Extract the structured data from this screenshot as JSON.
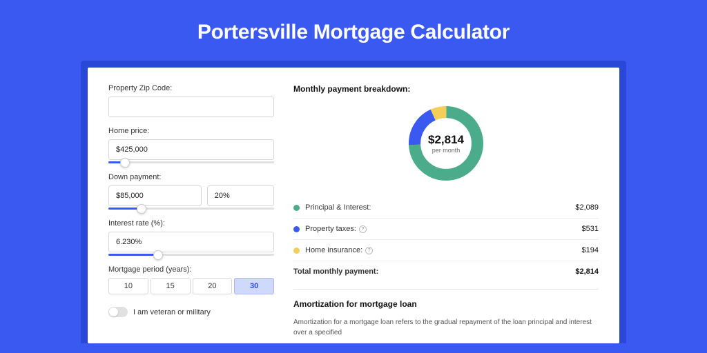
{
  "title": "Portersville Mortgage Calculator",
  "form": {
    "zip_label": "Property Zip Code:",
    "zip_value": "",
    "home_price_label": "Home price:",
    "home_price_value": "$425,000",
    "down_payment_label": "Down payment:",
    "down_payment_amount": "$85,000",
    "down_payment_percent": "20%",
    "interest_label": "Interest rate (%):",
    "interest_value": "6.230%",
    "period_label": "Mortgage period (years):",
    "periods": [
      "10",
      "15",
      "20",
      "30"
    ],
    "period_active": "30",
    "veteran_label": "I am veteran or military"
  },
  "breakdown": {
    "title": "Monthly payment breakdown:",
    "center_amount": "$2,814",
    "center_sub": "per month",
    "lines": [
      {
        "label": "Principal & Interest:",
        "value": "$2,089",
        "color": "#4bac8b",
        "info": false
      },
      {
        "label": "Property taxes:",
        "value": "$531",
        "color": "#3a59f0",
        "info": true
      },
      {
        "label": "Home insurance:",
        "value": "$194",
        "color": "#f3cf5a",
        "info": true
      }
    ],
    "total_label": "Total monthly payment:",
    "total_value": "$2,814"
  },
  "amort": {
    "title": "Amortization for mortgage loan",
    "text": "Amortization for a mortgage loan refers to the gradual repayment of the loan principal and interest over a specified"
  },
  "chart_data": {
    "type": "pie",
    "title": "Monthly payment breakdown",
    "series": [
      {
        "name": "Principal & Interest",
        "value": 2089,
        "color": "#4bac8b"
      },
      {
        "name": "Property taxes",
        "value": 531,
        "color": "#3a59f0"
      },
      {
        "name": "Home insurance",
        "value": 194,
        "color": "#f3cf5a"
      }
    ],
    "total": 2814,
    "unit": "USD/month"
  }
}
